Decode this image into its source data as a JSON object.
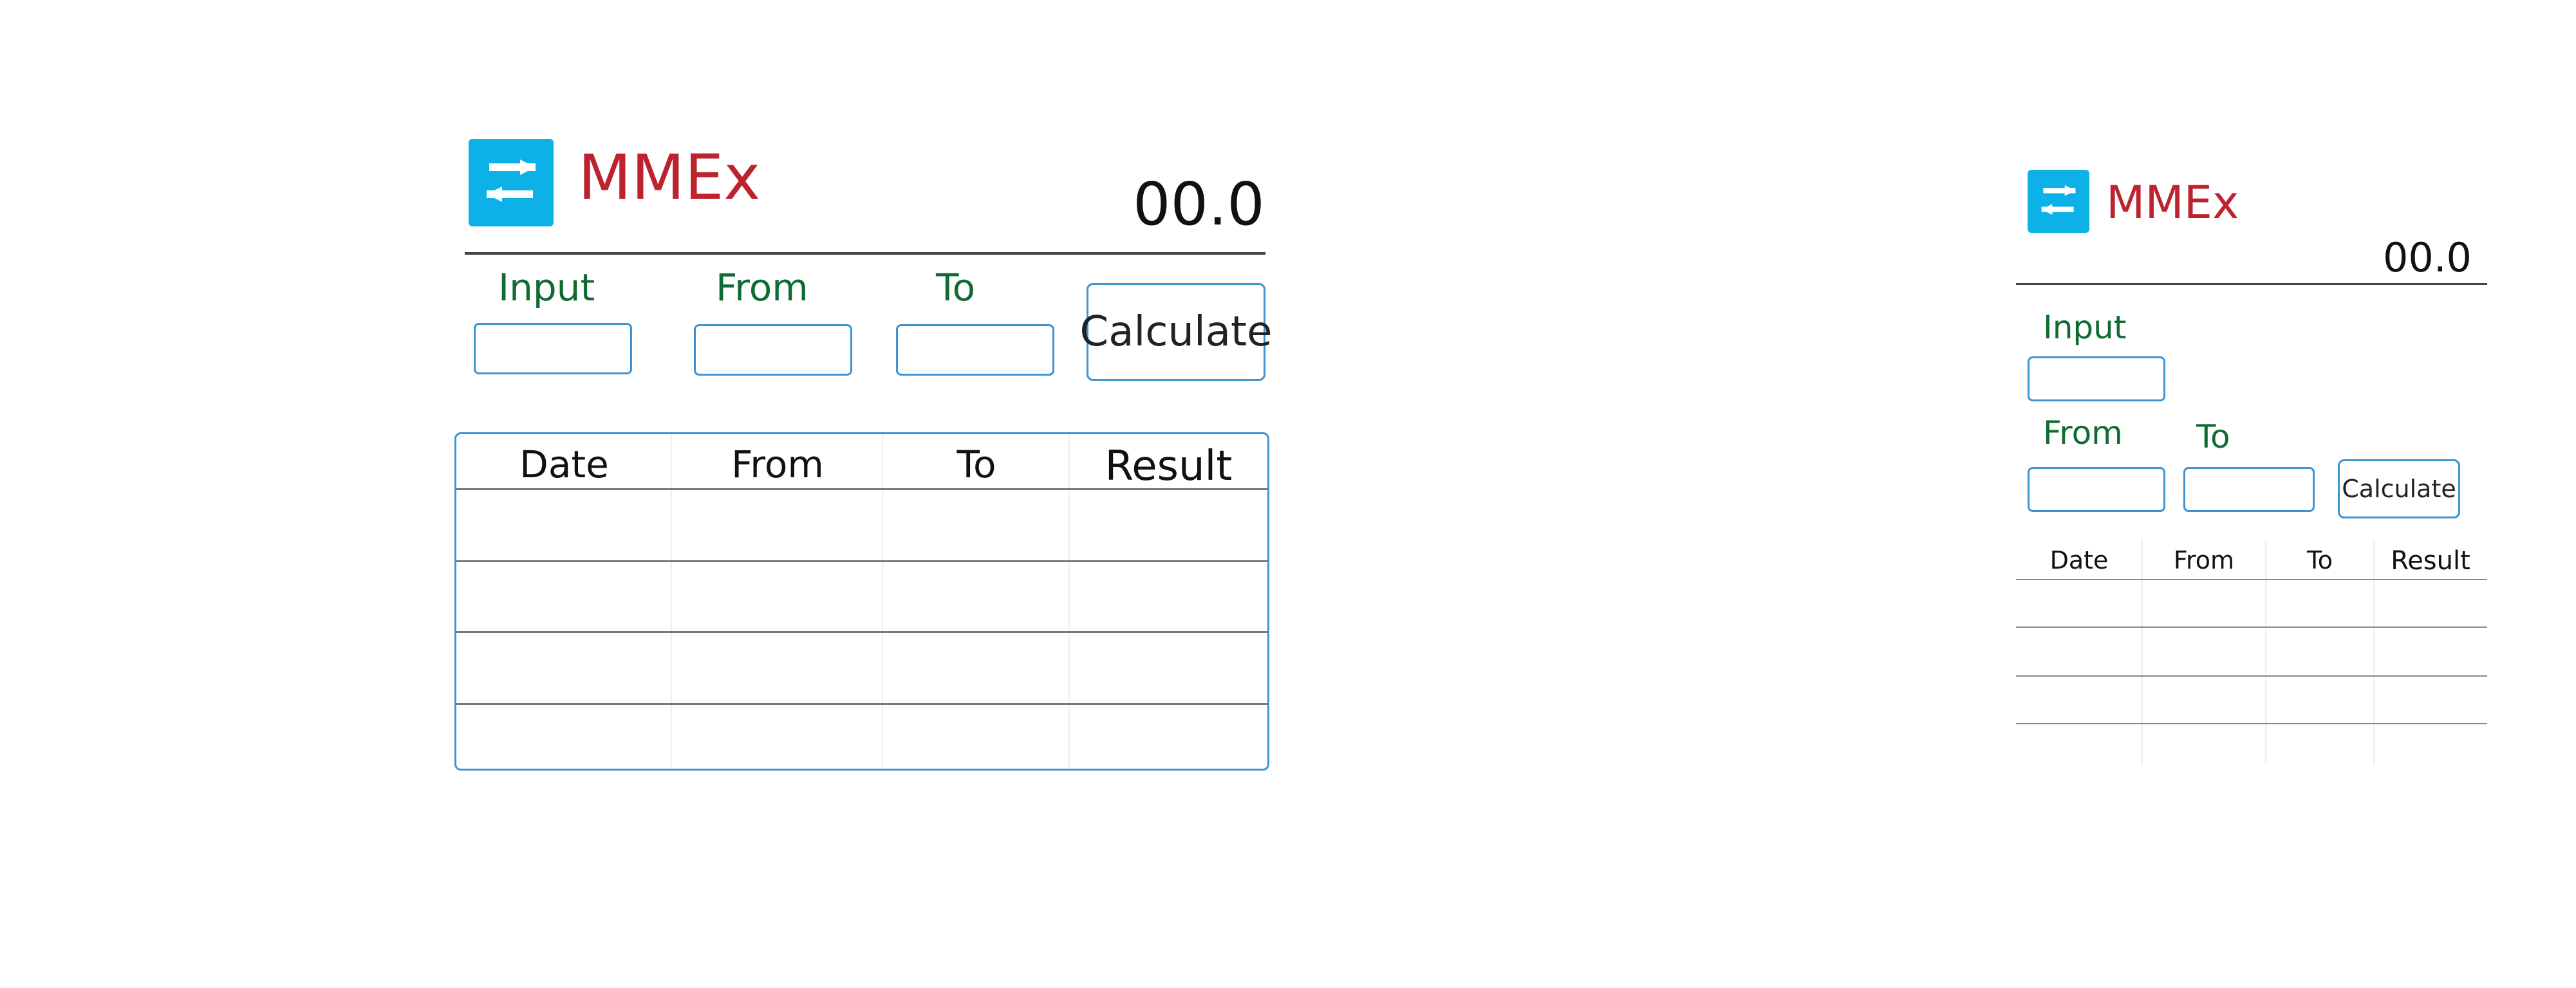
{
  "colors": {
    "brand_red": "#bd232e",
    "logo_blue": "#0bb1e7",
    "label_green": "#0f6b32",
    "border_blue": "#3c94d2"
  },
  "desktop": {
    "app_title": "MMEx",
    "logo_icon": "swap-arrows-icon",
    "display_value": "00.0",
    "labels": {
      "input": "Input",
      "from": "From",
      "to": "To"
    },
    "calculate_label": "Calculate",
    "table": {
      "headers": [
        "Date",
        "From",
        "To",
        "Result"
      ],
      "row_count": 4
    }
  },
  "mobile": {
    "app_title": "MMEx",
    "logo_icon": "swap-arrows-icon",
    "display_value": "00.0",
    "labels": {
      "input": "Input",
      "from": "From",
      "to": "To"
    },
    "calculate_label": "Calculate",
    "table": {
      "headers": [
        "Date",
        "From",
        "To",
        "Result"
      ],
      "row_count": 4
    }
  }
}
